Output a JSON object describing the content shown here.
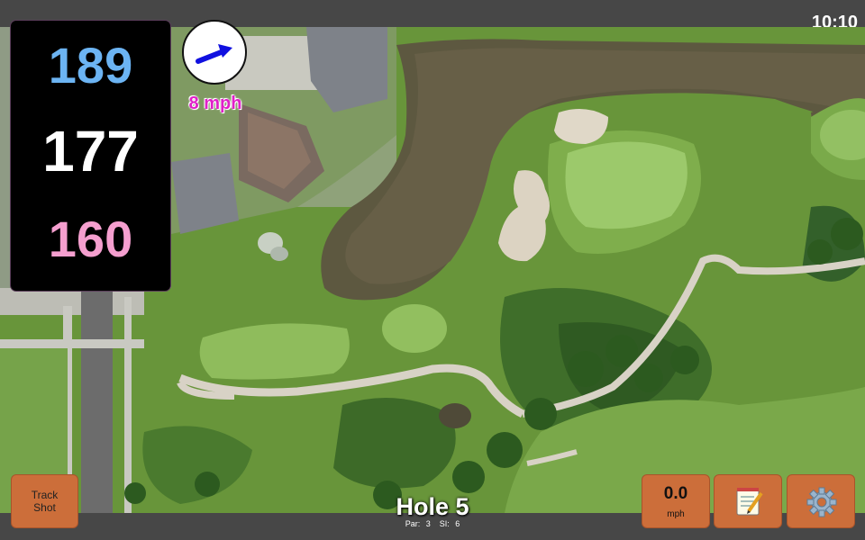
{
  "status": {
    "time": "10:10"
  },
  "distances": {
    "back": "189",
    "middle": "177",
    "front": "160"
  },
  "wind": {
    "speed": "8 mph",
    "icon": "wind-arrow-icon",
    "arrow_color": "#1010e0"
  },
  "hole": {
    "title": "Hole 5",
    "par": "Par: 3",
    "si": "SI: 6"
  },
  "buttons": {
    "track_shot": "Track\nShot",
    "speed_value": "0.0",
    "speed_unit": "mph",
    "notes_icon": "notepad-icon",
    "settings_icon": "gear-icon"
  },
  "colors": {
    "back_distance": "#6cb4f3",
    "middle_distance": "#ffffff",
    "front_distance": "#f59fcf",
    "wind_text": "#e020c8",
    "button": "#cc6e3a"
  }
}
